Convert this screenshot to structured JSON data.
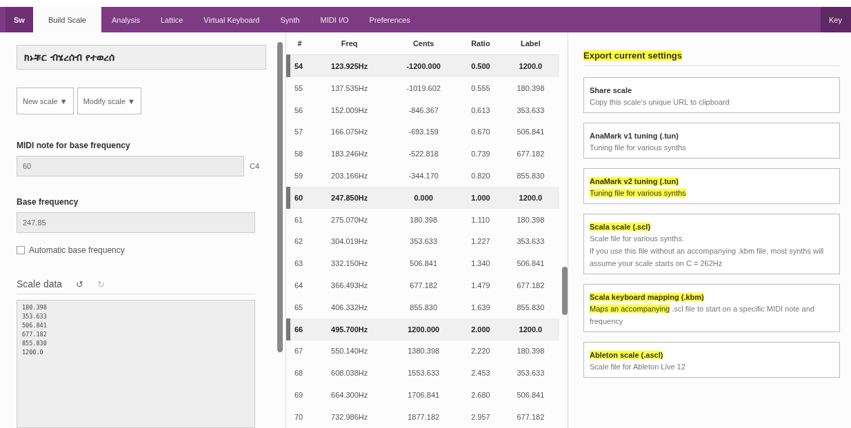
{
  "nav": {
    "tabs": [
      {
        "label": "Sw",
        "selected": false,
        "kind": "brand"
      },
      {
        "label": "Build Scale",
        "selected": true,
        "kind": "tab"
      },
      {
        "label": "Analysis",
        "selected": false,
        "kind": "tab"
      },
      {
        "label": "Lattice",
        "selected": false,
        "kind": "tab"
      },
      {
        "label": "Virtual Keyboard",
        "selected": false,
        "kind": "tab"
      },
      {
        "label": "Synth",
        "selected": false,
        "kind": "tab"
      },
      {
        "label": "MIDI I/O",
        "selected": false,
        "kind": "tab"
      },
      {
        "label": "Preferences",
        "selected": false,
        "kind": "tab"
      }
    ],
    "right_tab": "Key"
  },
  "scale_name": "ክኑቹር ብሄረሰብ የተወረሰ",
  "menu_buttons": [
    "New scale ▼",
    "Modify scale ▼"
  ],
  "midi_note": {
    "label": "MIDI note for base frequency",
    "value": "60",
    "note": "C4"
  },
  "base_frequency": {
    "label": "Base frequency",
    "value": "247.85"
  },
  "auto_base": {
    "label": "Automatic base frequency",
    "checked": false
  },
  "scale_data": {
    "label": "Scale data",
    "undo": "↺",
    "redo": "↻",
    "lines": [
      "180.398",
      "353.633",
      "506.841",
      "677.182",
      "855.830",
      "1200.0"
    ]
  },
  "table": {
    "columns": [
      "#",
      "Freq",
      "Cents",
      "Ratio",
      "Label"
    ],
    "rows": [
      {
        "cells": [
          "54",
          "123.925Hz",
          "-1200.000",
          "0.500",
          "1200.0"
        ],
        "bold": true
      },
      {
        "cells": [
          "55",
          "137.535Hz",
          "-1019.602",
          "0.555",
          "180.398"
        ],
        "bold": false
      },
      {
        "cells": [
          "56",
          "152.009Hz",
          "-846.367",
          "0.613",
          "353.633"
        ],
        "bold": false
      },
      {
        "cells": [
          "57",
          "166.075Hz",
          "-693.159",
          "0.670",
          "506.841"
        ],
        "bold": false
      },
      {
        "cells": [
          "58",
          "183.246Hz",
          "-522.818",
          "0.739",
          "677.182"
        ],
        "bold": false
      },
      {
        "cells": [
          "59",
          "203.166Hz",
          "-344.170",
          "0.820",
          "855.830"
        ],
        "bold": false
      },
      {
        "cells": [
          "60",
          "247.850Hz",
          "0.000",
          "1.000",
          "1200.0"
        ],
        "bold": true
      },
      {
        "cells": [
          "61",
          "275.070Hz",
          "180.398",
          "1.110",
          "180.398"
        ],
        "bold": false
      },
      {
        "cells": [
          "62",
          "304.019Hz",
          "353.633",
          "1.227",
          "353.633"
        ],
        "bold": false
      },
      {
        "cells": [
          "63",
          "332.150Hz",
          "506.841",
          "1.340",
          "506.841"
        ],
        "bold": false
      },
      {
        "cells": [
          "64",
          "366.493Hz",
          "677.182",
          "1.479",
          "677.182"
        ],
        "bold": false
      },
      {
        "cells": [
          "65",
          "406.332Hz",
          "855.830",
          "1.639",
          "855.830"
        ],
        "bold": false
      },
      {
        "cells": [
          "66",
          "495.700Hz",
          "1200.000",
          "2.000",
          "1200.0"
        ],
        "bold": true
      },
      {
        "cells": [
          "67",
          "550.140Hz",
          "1380.398",
          "2.220",
          "180.398"
        ],
        "bold": false
      },
      {
        "cells": [
          "68",
          "608.038Hz",
          "1553.633",
          "2.453",
          "353.633"
        ],
        "bold": false
      },
      {
        "cells": [
          "69",
          "664.300Hz",
          "1706.841",
          "2.680",
          "506.841"
        ],
        "bold": false
      },
      {
        "cells": [
          "70",
          "732.986Hz",
          "1877.182",
          "2.957",
          "677.182"
        ],
        "bold": false
      }
    ]
  },
  "export": {
    "title": "Export current settings",
    "title_highlighted": true,
    "options": [
      {
        "title": "Share scale",
        "title_highlighted": false,
        "lines": [
          [
            {
              "text": "Copy this scale's unique URL to clipboard",
              "highlighted": false
            }
          ]
        ]
      },
      {
        "title": "AnaMark v1 tuning (.tun)",
        "title_highlighted": false,
        "lines": [
          [
            {
              "text": "Tuning file for various synths",
              "highlighted": false
            }
          ]
        ]
      },
      {
        "title": "AnaMark v2 tuning (.tun)",
        "title_highlighted": true,
        "lines": [
          [
            {
              "text": "Tuning file for various synths",
              "highlighted": true
            }
          ]
        ]
      },
      {
        "title": "Scala scale (.scl)",
        "title_highlighted": true,
        "lines": [
          [
            {
              "text": "Scale file for various synths.",
              "highlighted": false
            }
          ],
          [
            {
              "text": "If you use this file without an accompanying .kbm file, most synths will assume your scale starts on C = 262Hz",
              "highlighted": false
            }
          ]
        ]
      },
      {
        "title": "Scala keyboard mapping (.kbm)",
        "title_highlighted": true,
        "lines": [
          [
            {
              "text": "Maps an accompanying",
              "highlighted": true
            },
            {
              "text": " .scl file to start on a specific MIDI note and frequency",
              "highlighted": false
            }
          ]
        ]
      },
      {
        "title": "Ableton scale (.ascl)",
        "title_highlighted": true,
        "lines": [
          [
            {
              "text": "Scale file for Ableton Live 12",
              "highlighted": false
            }
          ]
        ]
      }
    ]
  }
}
